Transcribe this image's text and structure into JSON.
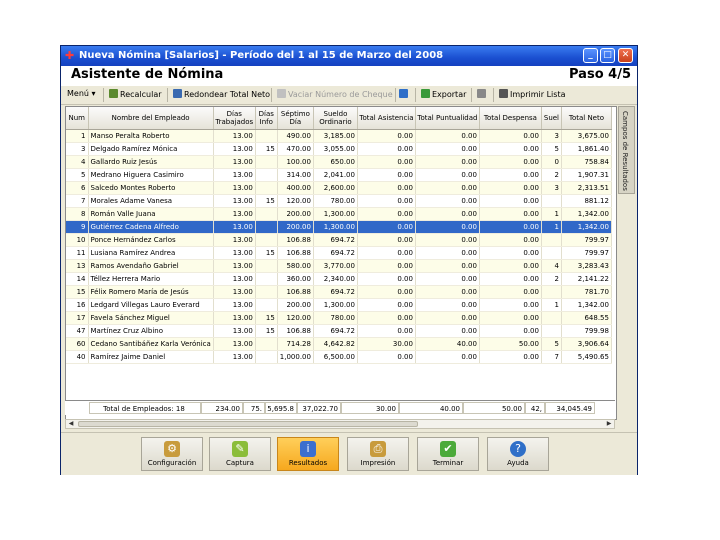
{
  "window": {
    "title": "Nueva Nómina [Salarios] - Período del 1 al 15 de Marzo del 2008",
    "accent": "#1a4fd0"
  },
  "wizard": {
    "title": "Asistente de Nómina",
    "step": "Paso 4/5"
  },
  "toolbar": {
    "menu": "Menú",
    "recalcular": "Recalcular",
    "redondear": "Redondear Total Neto",
    "vaciar": "Vaciar Número de Cheque",
    "exportar": "Exportar",
    "imprimir": "Imprimir Lista"
  },
  "grid": {
    "columns": [
      "Num",
      "Nombre del Empleado",
      "Días\nTrabajados",
      "Días\nInfo",
      "Séptimo\nDía",
      "Sueldo\nOrdinario",
      "Total Asistencia",
      "Total Puntualidad",
      "Total Despensa",
      "Suel",
      "Total Neto"
    ],
    "rows": [
      [
        "1",
        "Manso Peralta Roberto",
        "13.00",
        "",
        "490.00",
        "3,185.00",
        "0.00",
        "0.00",
        "0.00",
        "3",
        "3,675.00"
      ],
      [
        "3",
        "Delgado Ramírez Mónica",
        "13.00",
        "15",
        "470.00",
        "3,055.00",
        "0.00",
        "0.00",
        "0.00",
        "5",
        "1,861.40"
      ],
      [
        "4",
        "Gallardo Ruiz Jesús",
        "13.00",
        "",
        "100.00",
        "650.00",
        "0.00",
        "0.00",
        "0.00",
        "0",
        "758.84"
      ],
      [
        "5",
        "Medrano Higuera Casimiro",
        "13.00",
        "",
        "314.00",
        "2,041.00",
        "0.00",
        "0.00",
        "0.00",
        "2",
        "1,907.31"
      ],
      [
        "6",
        "Salcedo Montes Roberto",
        "13.00",
        "",
        "400.00",
        "2,600.00",
        "0.00",
        "0.00",
        "0.00",
        "3",
        "2,313.51"
      ],
      [
        "7",
        "Morales Adame Vanesa",
        "13.00",
        "15",
        "120.00",
        "780.00",
        "0.00",
        "0.00",
        "0.00",
        "",
        "881.12"
      ],
      [
        "8",
        "Román Valle Juana",
        "13.00",
        "",
        "200.00",
        "1,300.00",
        "0.00",
        "0.00",
        "0.00",
        "1",
        "1,342.00"
      ],
      [
        "9",
        "Gutiérrez Cadena Alfredo",
        "13.00",
        "",
        "200.00",
        "1,300.00",
        "0.00",
        "0.00",
        "0.00",
        "1",
        "1,342.00"
      ],
      [
        "10",
        "Ponce Hernández Carlos",
        "13.00",
        "",
        "106.88",
        "694.72",
        "0.00",
        "0.00",
        "0.00",
        "",
        "799.97"
      ],
      [
        "11",
        "Lusiana Ramírez Andrea",
        "13.00",
        "15",
        "106.88",
        "694.72",
        "0.00",
        "0.00",
        "0.00",
        "",
        "799.97"
      ],
      [
        "13",
        "Ramos Avendaño Gabriel",
        "13.00",
        "",
        "580.00",
        "3,770.00",
        "0.00",
        "0.00",
        "0.00",
        "4",
        "3,283.43"
      ],
      [
        "14",
        "Téllez Herrera Mario",
        "13.00",
        "",
        "360.00",
        "2,340.00",
        "0.00",
        "0.00",
        "0.00",
        "2",
        "2,141.22"
      ],
      [
        "15",
        "Félix Romero María de Jesús",
        "13.00",
        "",
        "106.88",
        "694.72",
        "0.00",
        "0.00",
        "0.00",
        "",
        "781.70"
      ],
      [
        "16",
        "Ledgard Villegas Lauro Everard",
        "13.00",
        "",
        "200.00",
        "1,300.00",
        "0.00",
        "0.00",
        "0.00",
        "1",
        "1,342.00"
      ],
      [
        "17",
        "Favela Sánchez Miguel",
        "13.00",
        "15",
        "120.00",
        "780.00",
        "0.00",
        "0.00",
        "0.00",
        "",
        "648.55"
      ],
      [
        "47",
        "Martínez Cruz Albino",
        "13.00",
        "15",
        "106.88",
        "694.72",
        "0.00",
        "0.00",
        "0.00",
        "",
        "799.98"
      ],
      [
        "60",
        "Cedano Santibáñez Karla Verónica",
        "13.00",
        "",
        "714.28",
        "4,642.82",
        "30.00",
        "40.00",
        "50.00",
        "5",
        "3,906.64"
      ],
      [
        "40",
        "Ramírez Jaime Daniel",
        "13.00",
        "",
        "1,000.00",
        "6,500.00",
        "0.00",
        "0.00",
        "0.00",
        "7",
        "5,490.65"
      ]
    ],
    "selected_row": 7
  },
  "totals": {
    "label": "Total de Empleados: 18",
    "dias": "234.00",
    "info": "75.",
    "septimo": "5,695.8",
    "sueldo": "37,022.70",
    "asistencia": "30.00",
    "puntualidad": "40.00",
    "despensa": "50.00",
    "suel": "42,",
    "neto": "34,045.49"
  },
  "sidetab": "Campos de Resultados",
  "bottom": {
    "configuracion": "Configuración",
    "captura": "Captura",
    "resultados": "Resultados",
    "impresion": "Impresión",
    "terminar": "Terminar",
    "ayuda": "Ayuda"
  }
}
